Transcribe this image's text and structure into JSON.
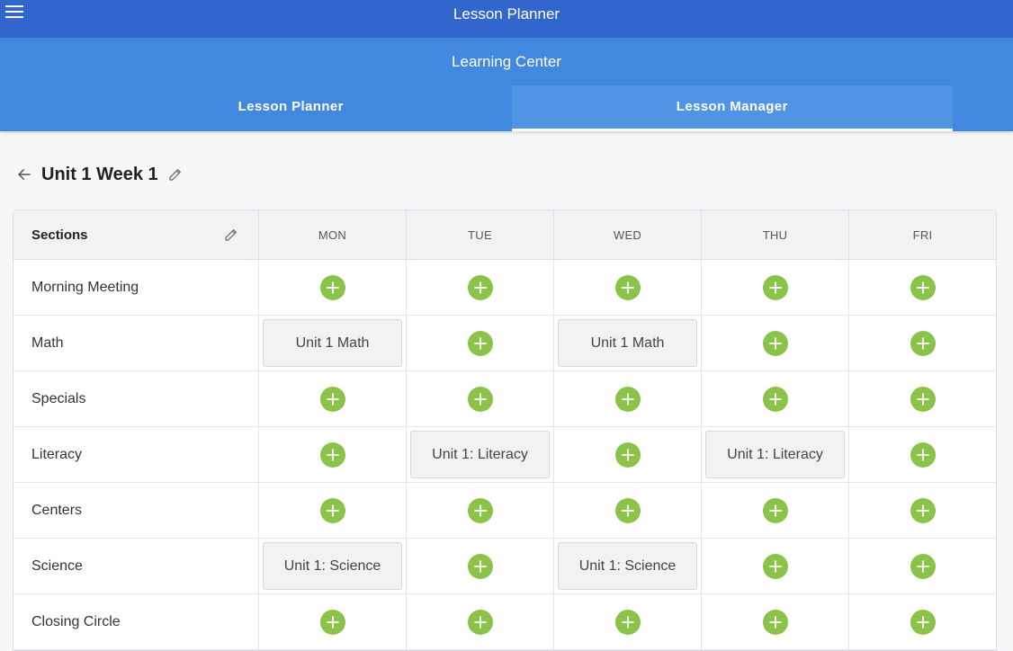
{
  "app": {
    "title": "Lesson Planner"
  },
  "subheader": {
    "title": "Learning Center"
  },
  "tabs": [
    {
      "label": "Lesson Planner",
      "active": false
    },
    {
      "label": "Lesson Manager",
      "active": true
    }
  ],
  "week": {
    "title": "Unit 1 Week 1"
  },
  "grid": {
    "sections_header": "Sections",
    "days": [
      "MON",
      "TUE",
      "WED",
      "THU",
      "FRI"
    ],
    "rows": [
      {
        "label": "Morning Meeting",
        "cells": [
          "",
          "",
          "",
          "",
          ""
        ]
      },
      {
        "label": "Math",
        "cells": [
          "Unit 1 Math",
          "",
          "Unit 1 Math",
          "",
          ""
        ]
      },
      {
        "label": "Specials",
        "cells": [
          "",
          "",
          "",
          "",
          ""
        ]
      },
      {
        "label": "Literacy",
        "cells": [
          "",
          "Unit 1: Literacy",
          "",
          "Unit 1: Literacy",
          ""
        ]
      },
      {
        "label": "Centers",
        "cells": [
          "",
          "",
          "",
          "",
          ""
        ]
      },
      {
        "label": "Science",
        "cells": [
          "Unit 1: Science",
          "",
          "Unit 1: Science",
          "",
          ""
        ]
      },
      {
        "label": "Closing Circle",
        "cells": [
          "",
          "",
          "",
          "",
          ""
        ]
      }
    ]
  },
  "icons": {
    "menu": "menu-icon",
    "back": "arrow-left-icon",
    "edit": "pencil-icon",
    "add": "plus-icon"
  },
  "colors": {
    "topbar": "#3366cc",
    "subheader": "#4288df",
    "active_tab": "#5095e4",
    "add_button": "#8bc34a"
  }
}
